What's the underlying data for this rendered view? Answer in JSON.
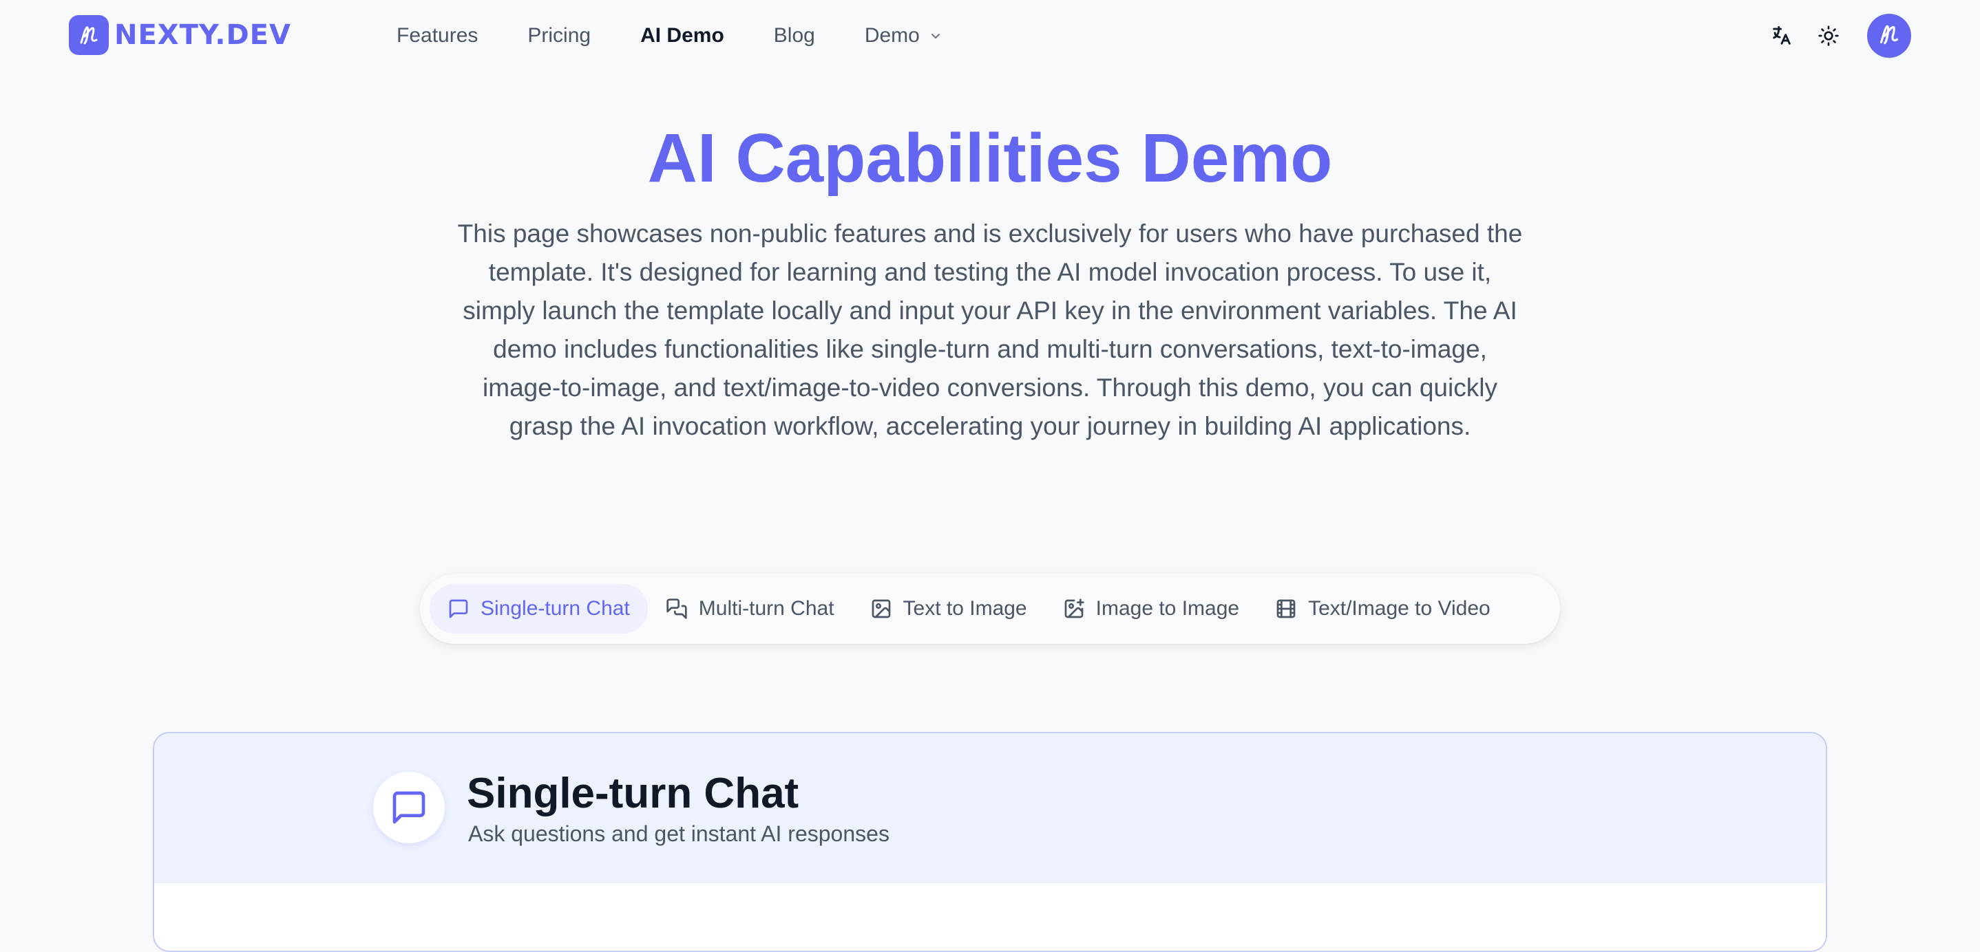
{
  "brand": {
    "name": "NEXTY.DEV",
    "logo_icon": "signature-n-icon",
    "color": "#6366f1"
  },
  "nav": {
    "items": [
      {
        "label": "Features",
        "active": false
      },
      {
        "label": "Pricing",
        "active": false
      },
      {
        "label": "AI Demo",
        "active": true
      },
      {
        "label": "Blog",
        "active": false
      },
      {
        "label": "Demo",
        "active": false,
        "has_dropdown": true
      }
    ]
  },
  "header_actions": {
    "language_icon": "translate-icon",
    "theme_icon": "sun-icon",
    "avatar_icon": "signature-n-icon"
  },
  "hero": {
    "title": "AI Capabilities Demo",
    "description": "This page showcases non-public features and is exclusively for users who have purchased the template. It's designed for learning and testing the AI model invocation process. To use it, simply launch the template locally and input your API key in the environment variables. The AI demo includes functionalities like single-turn and multi-turn conversations, text-to-image, image-to-image, and text/image-to-video conversions. Through this demo, you can quickly grasp the AI invocation workflow, accelerating your journey in building AI applications."
  },
  "tabs": [
    {
      "label": "Single-turn Chat",
      "icon": "message-square-icon",
      "active": true
    },
    {
      "label": "Multi-turn Chat",
      "icon": "messages-icon",
      "active": false
    },
    {
      "label": "Text to Image",
      "icon": "image-icon",
      "active": false
    },
    {
      "label": "Image to Image",
      "icon": "image-plus-icon",
      "active": false
    },
    {
      "label": "Text/Image to Video",
      "icon": "film-icon",
      "active": false
    }
  ],
  "panel": {
    "title": "Single-turn Chat",
    "subtitle": "Ask questions and get instant AI responses",
    "icon": "message-square-icon"
  },
  "colors": {
    "accent": "#6366f1",
    "background": "#f8f9fb",
    "active_tab_bg": "#eef0fd",
    "panel_header_bg": "#eef2fe"
  }
}
